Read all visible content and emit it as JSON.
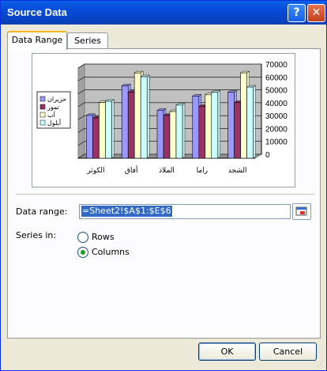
{
  "window": {
    "title": "Source Data",
    "help_glyph": "?",
    "close_glyph": "✕"
  },
  "tabs": [
    {
      "label": "Data Range",
      "active": true
    },
    {
      "label": "Series",
      "active": false
    }
  ],
  "chart_data": {
    "type": "bar",
    "categories": [
      "الكوثر",
      "أفاق",
      "الملاذ",
      "راما",
      "الشجد"
    ],
    "series": [
      {
        "name": "حزيران",
        "color": "#9999ff",
        "values": [
          32000,
          55000,
          36000,
          47000,
          50000
        ]
      },
      {
        "name": "تموز",
        "color": "#993366",
        "values": [
          30000,
          50000,
          32000,
          39000,
          42000
        ]
      },
      {
        "name": "آب",
        "color": "#ffffcc",
        "values": [
          42000,
          65000,
          35000,
          48000,
          65000
        ]
      },
      {
        "name": "أيلول",
        "color": "#ccffff",
        "values": [
          43000,
          62000,
          40000,
          50000,
          54000
        ]
      }
    ],
    "yticks": [
      "0",
      "10000",
      "20000",
      "30000",
      "40000",
      "50000",
      "60000",
      "70000"
    ],
    "ylim": [
      0,
      70000
    ],
    "grid": true,
    "plot_area_color": "#c0c0c0",
    "legend_position": "left",
    "y_axis_side": "right"
  },
  "form": {
    "data_range_label": "Data range:",
    "data_range_value": "=Sheet2!$A$1:$E$6",
    "series_in_label": "Series in:",
    "rows_label": "Rows",
    "columns_label": "Columns",
    "series_in_selected": "columns"
  },
  "buttons": {
    "ok": "OK",
    "cancel": "Cancel"
  }
}
